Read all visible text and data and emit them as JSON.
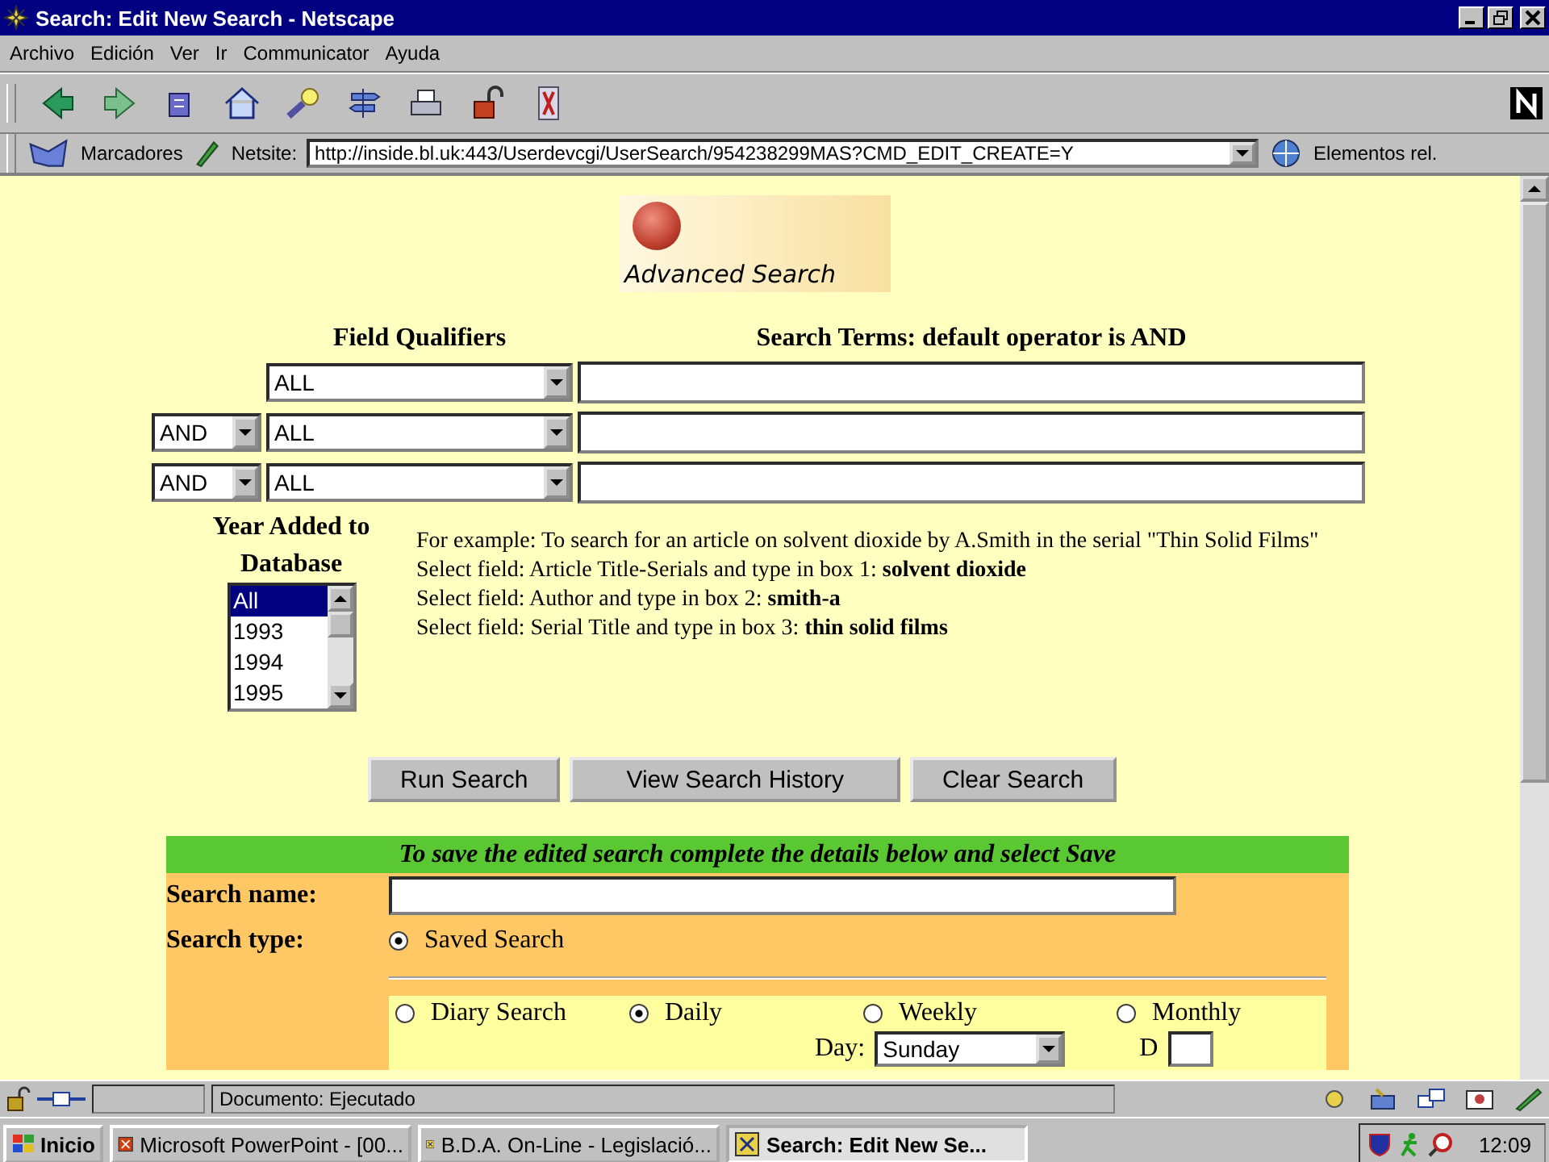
{
  "window": {
    "title": "Search: Edit New Search - Netscape"
  },
  "menu": [
    "Archivo",
    "Edición",
    "Ver",
    "Ir",
    "Communicator",
    "Ayuda"
  ],
  "location": {
    "bookmarks_label": "Marcadores",
    "netsite_label": "Netsite:",
    "url": "http://inside.bl.uk:443/Userdevcgi/UserSearch/954238299MAS?CMD_EDIT_CREATE=Y",
    "related_label": "Elementos rel."
  },
  "logo": {
    "caption": "Advanced Search"
  },
  "query": {
    "qualifiers_heading": "Field Qualifiers",
    "terms_heading": "Search Terms: default operator is AND",
    "rows": [
      {
        "qualifier": "ALL"
      },
      {
        "operator": "AND",
        "qualifier": "ALL"
      },
      {
        "operator": "AND",
        "qualifier": "ALL"
      }
    ]
  },
  "year": {
    "label": "Year Added to Database",
    "options": [
      {
        "label": "All",
        "selected": true
      },
      {
        "label": "1993",
        "selected": false
      },
      {
        "label": "1994",
        "selected": false
      },
      {
        "label": "1995",
        "selected": false
      }
    ]
  },
  "example": [
    "For example: To search for an article on solvent dioxide by A.Smith in the serial \"Thin Solid Films\"",
    "Select field: Article Title-Serials and type in box 1: **solvent dioxide**",
    "Select field: Author and type in box 2: **smith-a**",
    "Select field: Serial Title and type in box 3: **thin solid films**"
  ],
  "buttons": [
    "Run Search",
    "View Search History",
    "Clear Search"
  ],
  "save": {
    "banner": "To save the edited search complete the details below and select Save",
    "name_label": "Search name:",
    "type_label": "Search type:",
    "types": [
      {
        "label": "Saved Search",
        "selected": true
      }
    ],
    "schedules": [
      {
        "label": "Diary Search",
        "selected": false
      },
      {
        "label": "Daily",
        "selected": true
      },
      {
        "label": "Weekly",
        "selected": false
      },
      {
        "label": "Monthly",
        "selected": false
      }
    ],
    "day_label": "Day:",
    "day_value": "Sunday",
    "date_label": "D"
  },
  "status_bar": {
    "text": "Documento: Ejecutado"
  },
  "taskbar": {
    "start": "Inicio",
    "tasks": [
      {
        "label": "Microsoft PowerPoint - [00...",
        "selected": false
      },
      {
        "label": "B.D.A. On-Line - Legislació...",
        "selected": false
      },
      {
        "label": "Search: Edit New Se...",
        "selected": true
      }
    ],
    "clock": "12:09"
  }
}
